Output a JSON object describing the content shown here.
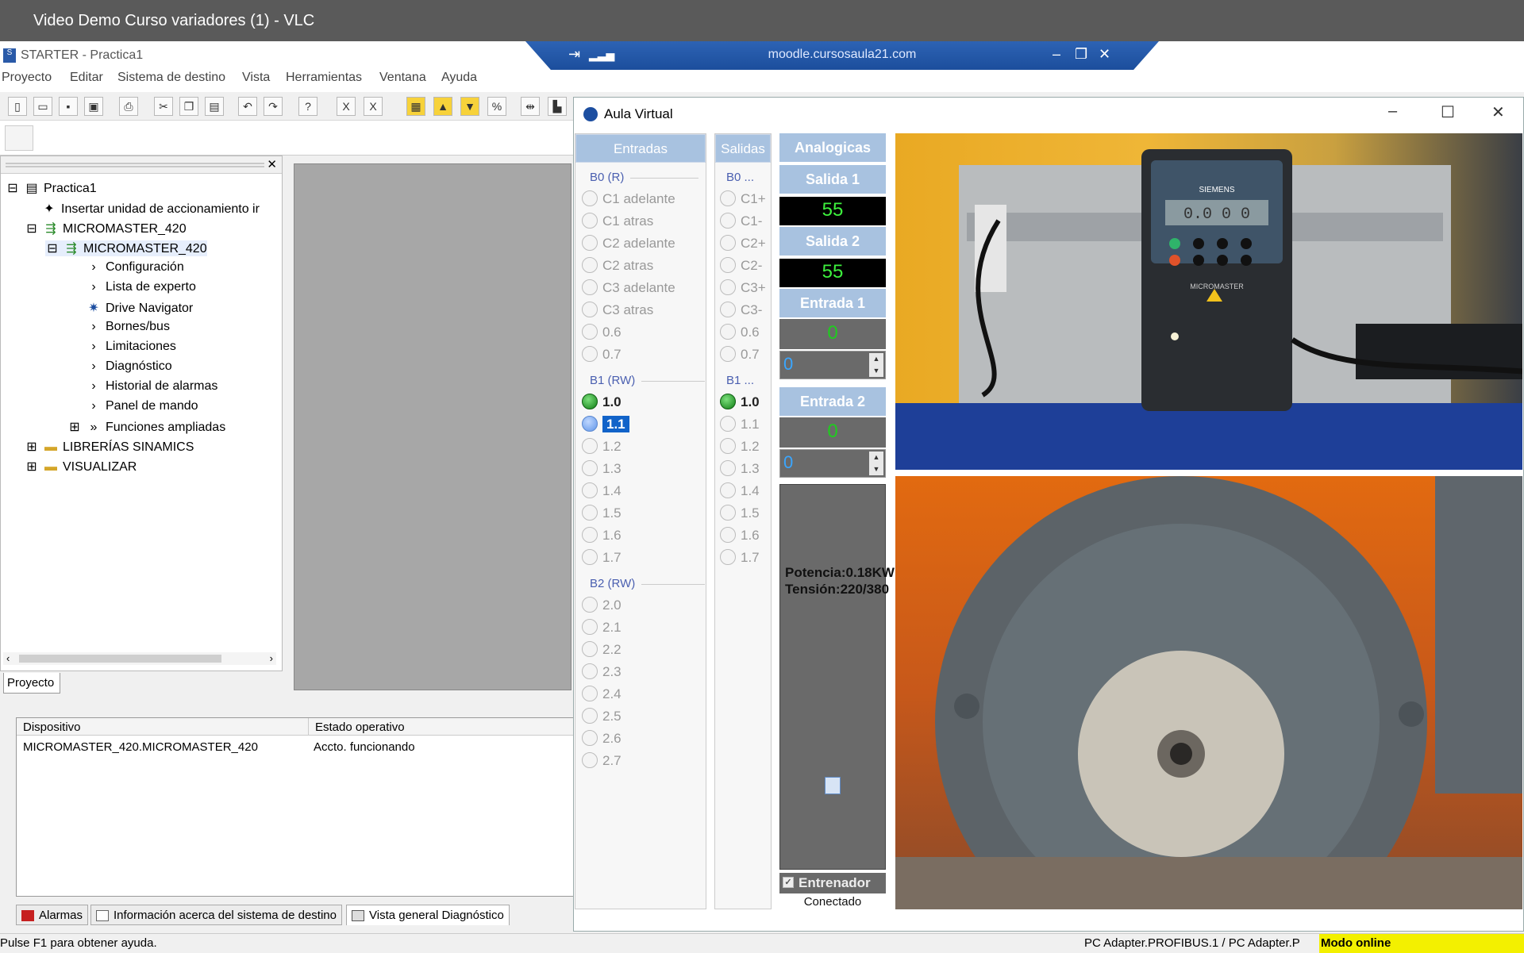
{
  "vlc": {
    "title": "Video Demo Curso variadores (1) - VLC"
  },
  "starter": {
    "title": "STARTER - Practica1"
  },
  "remote": {
    "url": "moodle.cursosaula21.com"
  },
  "menu": [
    "Proyecto",
    "Editar",
    "Sistema de destino",
    "Vista",
    "Herramientas",
    "Ventana",
    "Ayuda"
  ],
  "tree": {
    "root": "Practica1",
    "insert": "Insertar unidad de accionamiento ir",
    "device": "MICROMASTER_420",
    "drive": "MICROMASTER_420",
    "children": [
      "Configuración",
      "Lista de experto",
      "Drive Navigator",
      "Bornes/bus",
      "Limitaciones",
      "Diagnóstico",
      "Historial de alarmas",
      "Panel de mando",
      "Funciones ampliadas"
    ],
    "libs": "LIBRERÍAS SINAMICS",
    "visualize": "VISUALIZAR"
  },
  "project_tab": "Proyecto",
  "table": {
    "headers": [
      "Dispositivo",
      "Estado operativo"
    ],
    "rows": [
      [
        "MICROMASTER_420.MICROMASTER_420",
        "Accto. funcionando"
      ]
    ]
  },
  "bottom_tabs": [
    "Alarmas",
    "Información acerca del sistema de destino",
    "Vista general Diagnóstico"
  ],
  "status": {
    "help": "Pulse F1 para obtener ayuda.",
    "adapter": "PC Adapter.PROFIBUS.1 / PC Adapter.P",
    "mode": "Modo online"
  },
  "aula": {
    "title": "Aula Virtual",
    "entradas_header": "Entradas",
    "salidas_header": "Salidas",
    "analog_header": "Analogicas",
    "b0": "B0 (R)",
    "b1": "B1 (RW)",
    "b2": "B2 (RW)",
    "b0_out": "B0 ...",
    "b1_out": "B1 ...",
    "inputs_b0": [
      "C1 adelante",
      "C1 atras",
      "C2 adelante",
      "C2 atras",
      "C3 adelante",
      "C3 atras",
      "0.6",
      "0.7"
    ],
    "inputs_b1": [
      "1.0",
      "1.1",
      "1.2",
      "1.3",
      "1.4",
      "1.5",
      "1.6",
      "1.7"
    ],
    "inputs_b2": [
      "2.0",
      "2.1",
      "2.2",
      "2.3",
      "2.4",
      "2.5",
      "2.6",
      "2.7"
    ],
    "outputs_b0": [
      "C1+",
      "C1-",
      "C2+",
      "C2-",
      "C3+",
      "C3-",
      "0.6",
      "0.7"
    ],
    "outputs_b1": [
      "1.0",
      "1.1",
      "1.2",
      "1.3",
      "1.4",
      "1.5",
      "1.6",
      "1.7"
    ],
    "salida1_label": "Salida 1",
    "salida1_value": "55",
    "salida2_label": "Salida 2",
    "salida2_value": "55",
    "entrada1_label": "Entrada 1",
    "entrada1_value": "0",
    "entrada1_spin": "0",
    "entrada2_label": "Entrada 2",
    "entrada2_value": "0",
    "entrada2_spin": "0",
    "power_text": "Potencia:0.18KW Tensión:220/380",
    "trainer": "Entrenador",
    "trainer_checked": true,
    "connected": "Conectado"
  },
  "camera": {
    "brand": "SIEMENS",
    "model": "MICROMASTER",
    "display": "0.0 0 0"
  },
  "colors": {
    "header_blue": "#a8c2e0",
    "led_green": "#0f7d14",
    "online_yellow": "#f3f000",
    "value_green": "#3df03d"
  }
}
